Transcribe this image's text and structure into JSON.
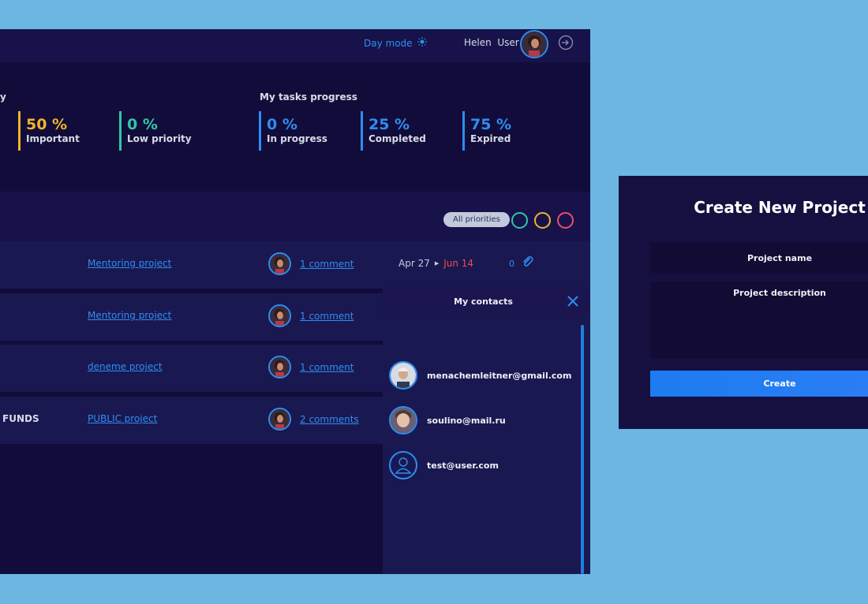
{
  "header": {
    "day_mode_label": "Day mode",
    "user_first": "Helen",
    "user_last": "User"
  },
  "stats": {
    "left_group_title_fragment": "y",
    "tasks_progress_title": "My tasks progress",
    "priority": [
      {
        "value": "50 %",
        "label": "Important",
        "color": "#f0b42a"
      },
      {
        "value": "0 %",
        "label": "Low priority",
        "color": "#2fc7a8"
      }
    ],
    "progress": [
      {
        "value": "0 %",
        "label": "In progress",
        "color": "#2d8ef2"
      },
      {
        "value": "25 %",
        "label": "Completed",
        "color": "#2d8ef2"
      },
      {
        "value": "75 %",
        "label": "Expired",
        "color": "#2d8ef2"
      }
    ]
  },
  "filters": {
    "all_priorities": "All priorities",
    "priority_colors": [
      "#2fc7a8",
      "#f0b42a",
      "#ef4d6b"
    ]
  },
  "tasks": [
    {
      "name": "",
      "project": "Mentoring project",
      "comments": "1 comment",
      "start": "Apr 27",
      "end": "Jun 14",
      "attachments": "0"
    },
    {
      "name": "",
      "project": "Mentoring project",
      "comments": "1 comment"
    },
    {
      "name": "",
      "project": "deneme project",
      "comments": "1 comment"
    },
    {
      "name": "FUNDS",
      "project": "PUBLIC project",
      "comments": "2 comments"
    }
  ],
  "contacts_panel": {
    "title": "My contacts",
    "contacts": [
      {
        "email": "menachemleitner@gmail.com",
        "avatar": "photo"
      },
      {
        "email": "soulino@mail.ru",
        "avatar": "photo"
      },
      {
        "email": "test@user.com",
        "avatar": "person-icon"
      }
    ]
  },
  "modal": {
    "title": "Create New Project",
    "name_placeholder": "Project name",
    "description_placeholder": "Project description",
    "create_label": "Create"
  },
  "colors": {
    "accent": "#2d8ef2",
    "end_date": "#ef4d4d",
    "page_bg": "#6cb6e2",
    "app_bg": "#120c3a"
  }
}
